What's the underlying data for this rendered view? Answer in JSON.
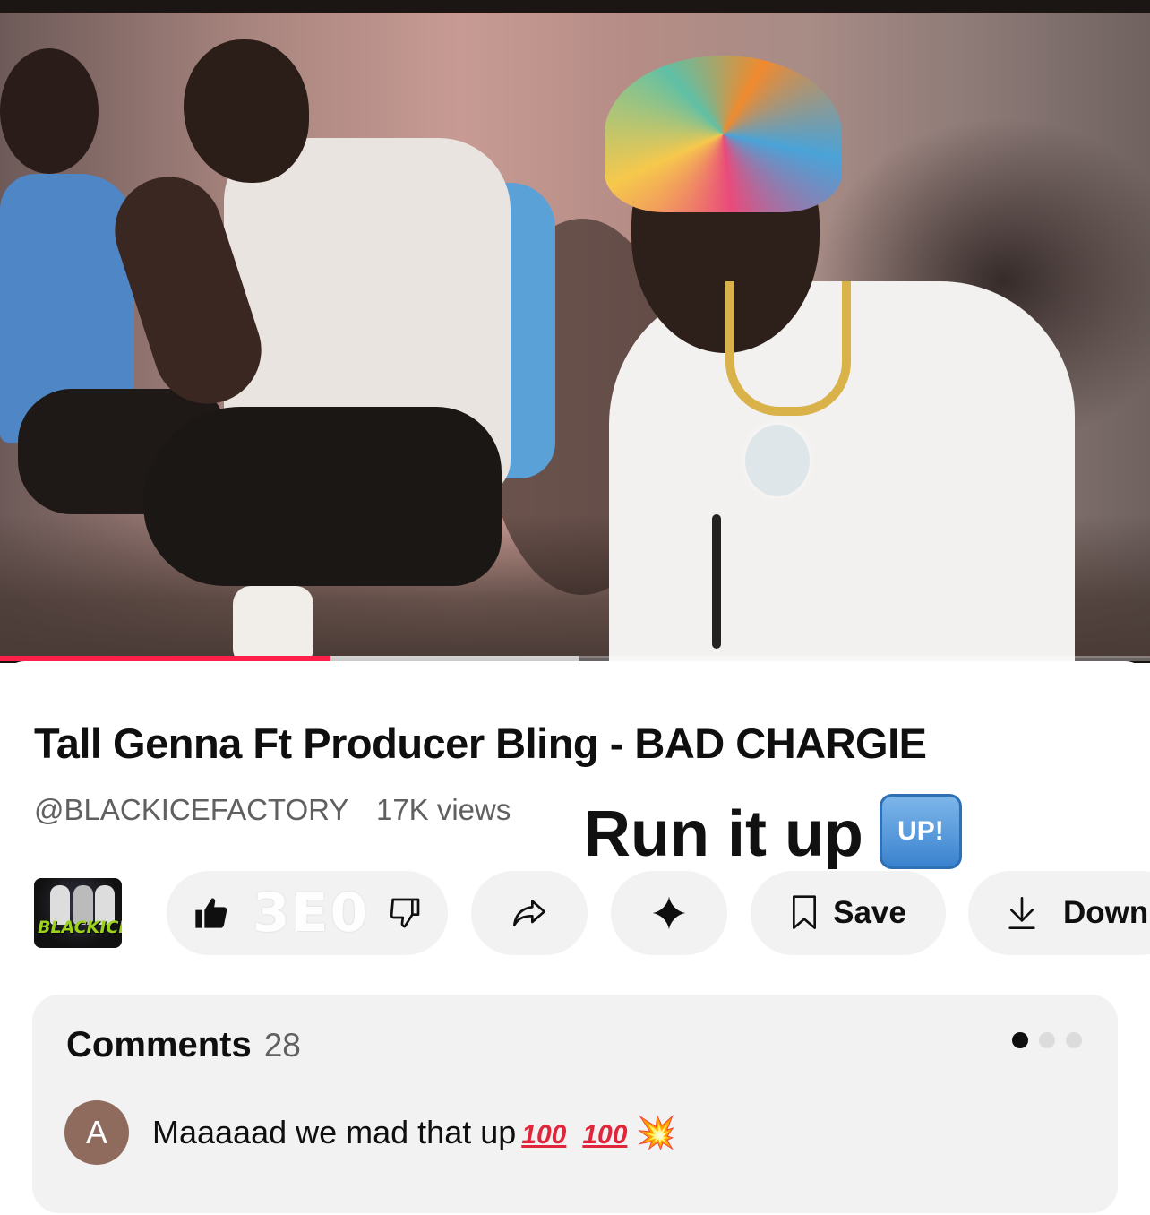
{
  "video": {
    "progress": 0.287,
    "buffered": 0.503,
    "accent_color": "#ff1f4b"
  },
  "title": "Tall Genna Ft Producer Bling - BAD CHARGIE",
  "channel": {
    "handle": "@BLACKICEFACTORY",
    "views": "17K views",
    "logo_text": "BLACKICE"
  },
  "caption_overlay": {
    "text": "Run it up",
    "badge": "UP!"
  },
  "actions": {
    "like_icon": "thumbs-up-icon",
    "like_count": "3E0",
    "dislike_icon": "thumbs-down-icon",
    "share_icon": "share-icon",
    "ai_icon": "sparkle-icon",
    "save_label": "Save",
    "save_icon": "bookmark-icon",
    "download_label": "Down",
    "download_icon": "download-icon"
  },
  "comments": {
    "heading": "Comments",
    "count": "28",
    "top_comment": {
      "avatar_letter": "A",
      "text": "Maaaaad we mad that up",
      "emoji_1": "100",
      "emoji_2": "100",
      "emoji_3": "💥"
    }
  }
}
